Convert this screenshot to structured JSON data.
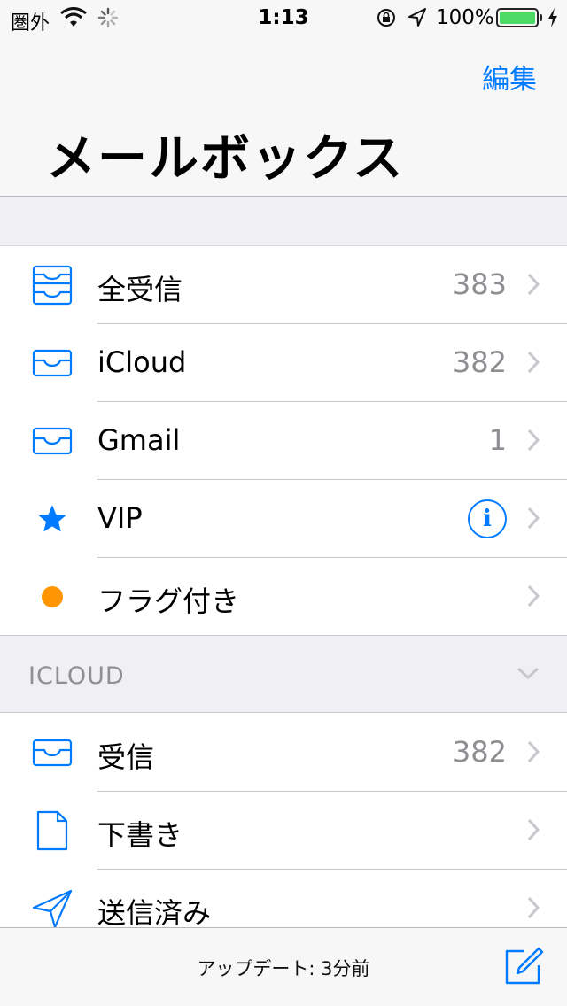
{
  "status": {
    "carrier": "圏外",
    "time": "1:13",
    "battery": "100%"
  },
  "nav": {
    "edit_label": "編集",
    "title": "メールボックス"
  },
  "mailboxes": [
    {
      "label": "全受信",
      "count": "383",
      "icon": "all-inbox-icon"
    },
    {
      "label": "iCloud",
      "count": "382",
      "icon": "inbox-icon"
    },
    {
      "label": "Gmail",
      "count": "1",
      "icon": "inbox-icon"
    },
    {
      "label": "VIP",
      "count": "",
      "icon": "star-icon"
    },
    {
      "label": "フラグ付き",
      "count": "",
      "icon": "flag-dot-icon"
    }
  ],
  "icloud_section": {
    "header": "ICLOUD",
    "items": [
      {
        "label": "受信",
        "count": "382",
        "icon": "inbox-icon"
      },
      {
        "label": "下書き",
        "count": "",
        "icon": "document-icon"
      },
      {
        "label": "送信済み",
        "count": "",
        "icon": "paper-plane-icon"
      }
    ]
  },
  "toolbar": {
    "update_text": "アップデート: 3分前"
  },
  "colors": {
    "accent": "#007aff",
    "flag": "#ff9500",
    "battery": "#4cd964"
  }
}
